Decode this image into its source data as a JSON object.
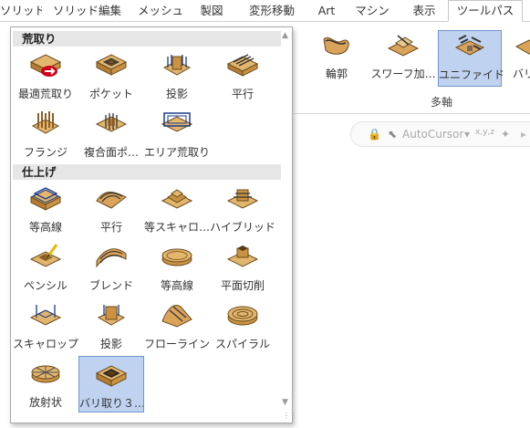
{
  "tabs": [
    {
      "label": "ソリッド"
    },
    {
      "label": "ソリッド編集"
    },
    {
      "label": "メッシュ"
    },
    {
      "label": "製図"
    },
    {
      "label": "変形移動"
    },
    {
      "label": "Art"
    },
    {
      "label": "マシン"
    },
    {
      "label": "表示"
    },
    {
      "label": "ツールパス"
    }
  ],
  "ribbon": {
    "buttons": [
      {
        "label": "輪郭"
      },
      {
        "label": "スワーフ加…"
      },
      {
        "label": "ユニファイド"
      },
      {
        "label": "バリ"
      }
    ],
    "group_label": "多軸"
  },
  "autocursor": {
    "label": "AutoCursor",
    "dropdown": "▾"
  },
  "panel": {
    "sections": [
      {
        "title": "荒取り"
      },
      {
        "title": "仕上げ"
      }
    ],
    "roughing": [
      {
        "label": "最適荒取り"
      },
      {
        "label": "ポケット"
      },
      {
        "label": "投影"
      },
      {
        "label": "平行"
      },
      {
        "label": "フランジ"
      },
      {
        "label": "複合面ポ…"
      },
      {
        "label": "エリア荒取り"
      }
    ],
    "finishing": [
      {
        "label": "等高線"
      },
      {
        "label": "平行"
      },
      {
        "label": "等スキャロ…"
      },
      {
        "label": "ハイブリッド"
      },
      {
        "label": "ペンシル"
      },
      {
        "label": "ブレンド"
      },
      {
        "label": "等高線"
      },
      {
        "label": "平面切削"
      },
      {
        "label": "スキャロップ"
      },
      {
        "label": "投影"
      },
      {
        "label": "フローライン"
      },
      {
        "label": "スパイラル"
      },
      {
        "label": "放射状"
      },
      {
        "label": "バリ取り３…"
      }
    ]
  },
  "colors": {
    "selected_bg": "#bfd3f0",
    "selected_border": "#6f94cf",
    "section_bg": "#e6e6e6",
    "wood": "#d9a35a"
  }
}
